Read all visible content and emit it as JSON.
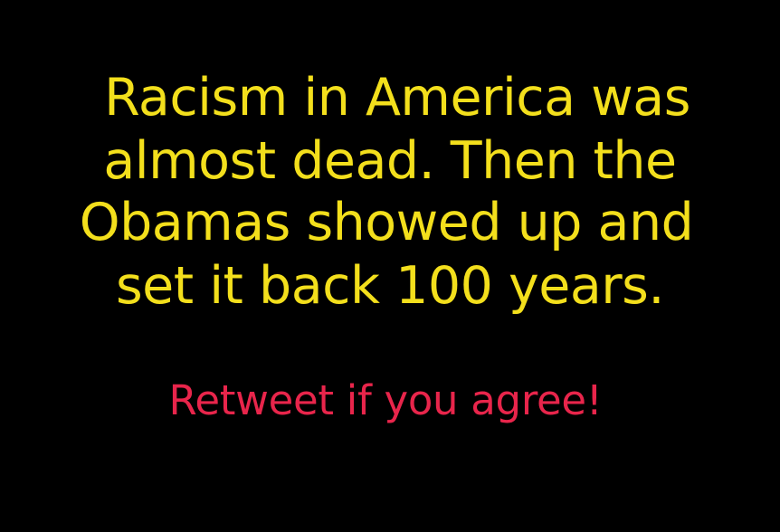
{
  "message": {
    "lines": [
      "Racism in America was",
      "almost dead. Then the",
      "Obamas showed up and",
      "set it back 100 years."
    ],
    "call_to_action": "Retweet if you agree!"
  },
  "colors": {
    "background": "#000000",
    "message_text": "#f3df1c",
    "call_to_action_text": "#e8254b"
  }
}
